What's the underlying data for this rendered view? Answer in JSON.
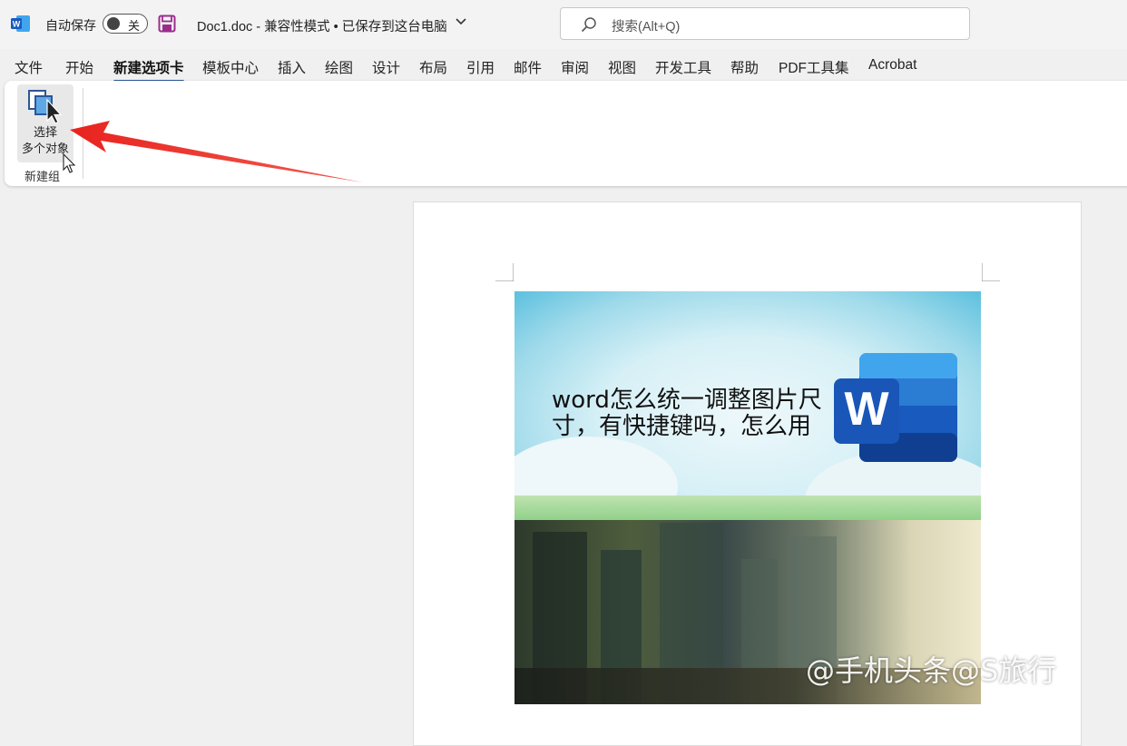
{
  "titlebar": {
    "autosave_label": "自动保存",
    "autosave_state": "关",
    "doc_title": "Doc1.doc  -  兼容性模式 • 已保存到这台电脑",
    "search_placeholder": "搜索(Alt+Q)"
  },
  "tabs": [
    {
      "label": "文件",
      "active": false
    },
    {
      "label": "开始",
      "active": false
    },
    {
      "label": "新建选项卡",
      "active": true
    },
    {
      "label": "模板中心",
      "active": false
    },
    {
      "label": "插入",
      "active": false
    },
    {
      "label": "绘图",
      "active": false
    },
    {
      "label": "设计",
      "active": false
    },
    {
      "label": "布局",
      "active": false
    },
    {
      "label": "引用",
      "active": false
    },
    {
      "label": "邮件",
      "active": false
    },
    {
      "label": "审阅",
      "active": false
    },
    {
      "label": "视图",
      "active": false
    },
    {
      "label": "开发工具",
      "active": false
    },
    {
      "label": "帮助",
      "active": false
    },
    {
      "label": "PDF工具集",
      "active": false
    },
    {
      "label": "Acrobat",
      "active": false
    }
  ],
  "ribbon": {
    "select_button_line1": "选择",
    "select_button_line2": "多个对象",
    "group_label": "新建组"
  },
  "document": {
    "image_caption": "word怎么统一调整图片尺寸，有快捷键吗，怎么用",
    "logo_letter": "W"
  },
  "watermark": "@手机头条@S旅行",
  "colors": {
    "accent": "#2b579a",
    "arrow": "#e8231f",
    "save_icon": "#9b2c8e"
  }
}
